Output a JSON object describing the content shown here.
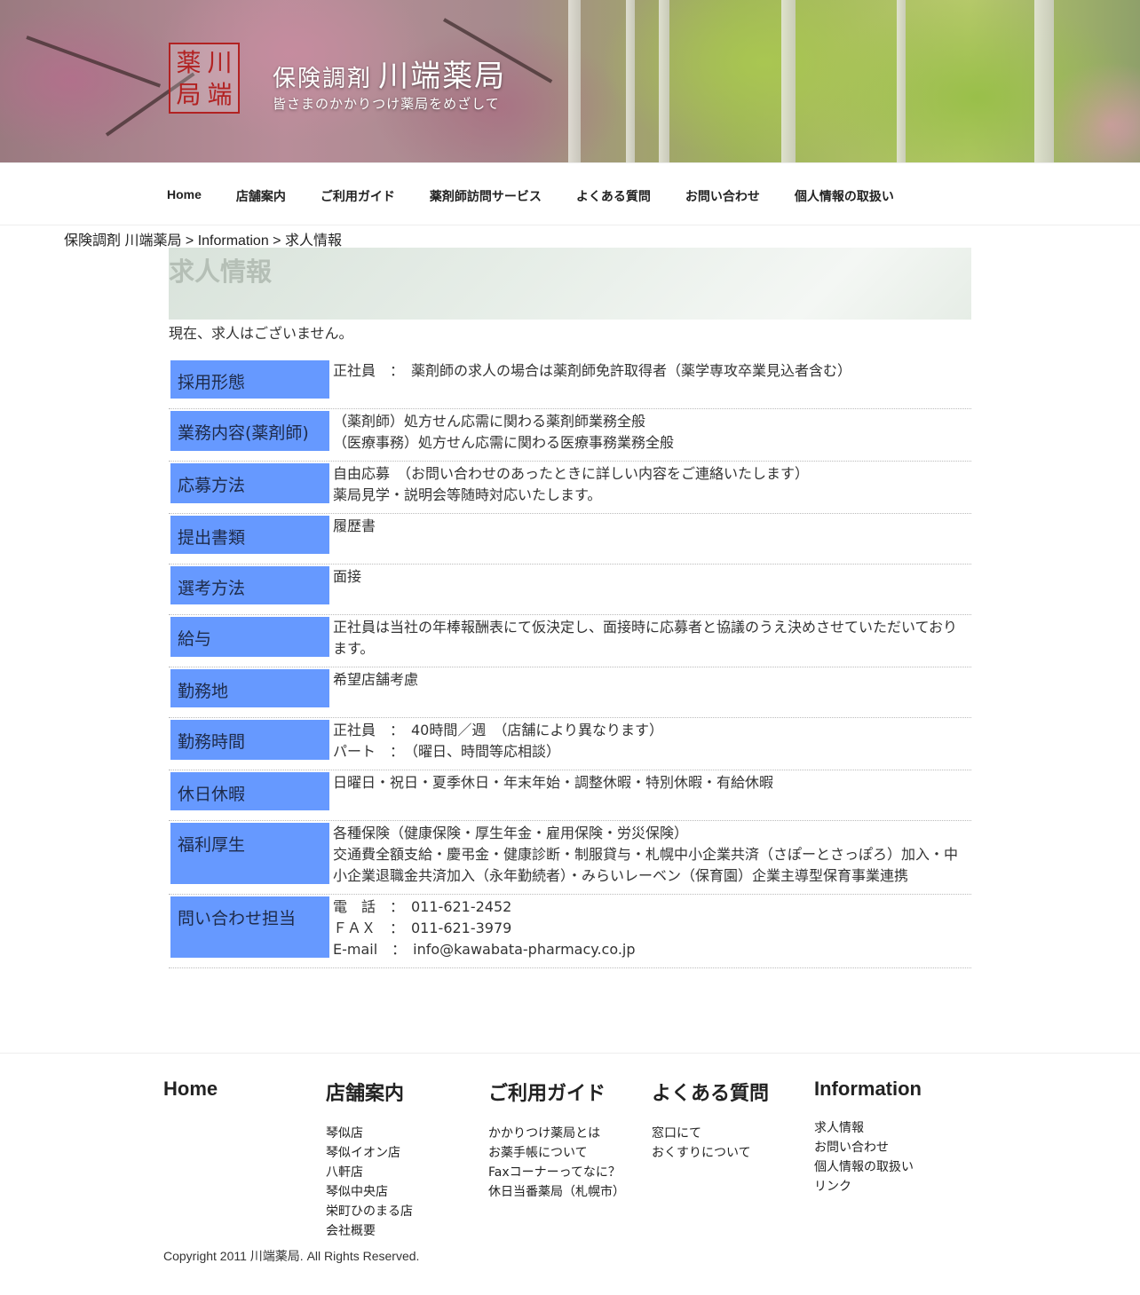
{
  "header": {
    "logo_chars": [
      "川",
      "薬",
      "端",
      "局"
    ],
    "title_small": "保険調剤",
    "title_big": "川端薬局",
    "description": "皆さまのかかりつけ薬局をめざして"
  },
  "nav": {
    "items": [
      "Home",
      "店舗案内",
      "ご利用ガイド",
      "薬剤師訪問サービス",
      "よくある質問",
      "お問い合わせ",
      "個人情報の取扱い"
    ]
  },
  "breadcrumb": {
    "home": "保険調剤 川端薬局",
    "sep1": " > ",
    "section": "Information",
    "sep2": " > ",
    "current": "求人情報"
  },
  "page": {
    "title": "求人情報",
    "intro": "現在、求人はございません。"
  },
  "job_rows": [
    {
      "label": "採用形態",
      "lines": [
        "正社員　：　薬剤師の求人の場合は薬剤師免許取得者（薬学専攻卒業見込者含む）"
      ]
    },
    {
      "label": "業務内容(薬剤師)",
      "lines": [
        "（薬剤師）処方せん応需に関わる薬剤師業務全般",
        "（医療事務）処方せん応需に関わる医療事務業務全般"
      ]
    },
    {
      "label": "応募方法",
      "lines": [
        "自由応募　（お問い合わせのあったときに詳しい内容をご連絡いたします）",
        "薬局見学・説明会等随時対応いたします。"
      ]
    },
    {
      "label": "提出書類",
      "lines": [
        "履歴書"
      ]
    },
    {
      "label": "選考方法",
      "lines": [
        "面接"
      ]
    },
    {
      "label": "給与",
      "lines": [
        "正社員は当社の年棒報酬表にて仮決定し、面接時に応募者と協議のうえ決めさせていただいております。"
      ]
    },
    {
      "label": "勤務地",
      "lines": [
        "希望店舗考慮"
      ]
    },
    {
      "label": "勤務時間",
      "lines": [
        "正社員　：　40時間／週　（店舗により異なります）",
        "パート　：　（曜日、時間等応相談）"
      ]
    },
    {
      "label": "休日休暇",
      "lines": [
        "日曜日・祝日・夏季休日・年末年始・調整休暇・特別休暇・有給休暇"
      ]
    },
    {
      "label": "福利厚生",
      "lines": [
        "各種保険（健康保険・厚生年金・雇用保険・労災保険）",
        "交通費全額支給・慶弔金・健康診断・制服貸与・札幌中小企業共済（さぽーとさっぽろ）加入・中小企業退職金共済加入（永年勤続者）・みらいレーベン（保育園）企業主導型保育事業連携"
      ]
    },
    {
      "label": "問い合わせ担当",
      "lines": [
        "電　話　：　011-621-2452",
        "ＦＡＸ　：　011-621-3979",
        "E-mail　：　info@kawabata-pharmacy.co.jp"
      ]
    }
  ],
  "footer": {
    "columns": [
      {
        "heading": "Home",
        "links": []
      },
      {
        "heading": "店舗案内",
        "links": [
          "琴似店",
          "琴似イオン店",
          "八軒店",
          "琴似中央店",
          "栄町ひのまる店",
          "会社概要"
        ]
      },
      {
        "heading": "ご利用ガイド",
        "links": [
          "かかりつけ薬局とは",
          "お薬手帳について",
          "Faxコーナーってなに？",
          "休日当番薬局（札幌市）"
        ]
      },
      {
        "heading": "よくある質問",
        "links": [
          "窓口にて",
          "おくすりについて"
        ]
      },
      {
        "heading": "Information",
        "links": [
          "求人情報",
          "お問い合わせ",
          "個人情報の取扱い",
          "リンク"
        ]
      }
    ],
    "copyright": "Copyright 2011 川端薬局. All Rights Reserved."
  },
  "colors": {
    "label_bg": "#6699ff",
    "logo_red": "#b22222",
    "title_gray": "#b5bfb6"
  }
}
